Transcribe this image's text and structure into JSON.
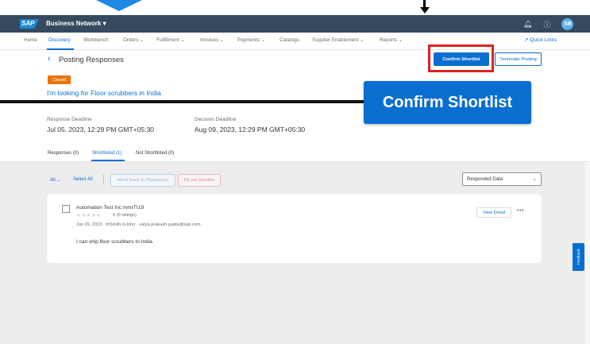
{
  "shell": {
    "logo_text": "SAP",
    "app_title": "Business Network ▾",
    "icons": [
      "bell-icon",
      "help-icon"
    ],
    "avatar_initials": "SB"
  },
  "nav": {
    "items": [
      {
        "label": "Home"
      },
      {
        "label": "Discovery"
      },
      {
        "label": "Workbench"
      },
      {
        "label": "Orders ⌄"
      },
      {
        "label": "Fulfillment ⌄"
      },
      {
        "label": "Invoices ⌄"
      },
      {
        "label": "Payments ⌄"
      },
      {
        "label": "Catalogs"
      },
      {
        "label": "Supplier Enablement ⌄"
      },
      {
        "label": "Reports ⌄"
      }
    ],
    "active": "Discovery",
    "quick_links": "↗ Quick Links"
  },
  "header": {
    "back_icon": "‹",
    "title": "Posting Responses",
    "confirm_label": "Confirm Shortlist",
    "terminate_label": "Terminate Posting",
    "status": "Closed",
    "posting_title": "I'm looking for Floor scrubbers in India"
  },
  "callout": {
    "label": "Confirm Shortlist"
  },
  "deadlines": {
    "response_label": "Response Deadline",
    "response_value": "Jul 05, 2023, 12:29 PM GMT+05:30",
    "decision_label": "Decision Deadline",
    "decision_value": "Aug 09, 2023, 12:29 PM GMT+05:30"
  },
  "tabs": [
    {
      "label": "Responses (0)"
    },
    {
      "label": "Shortlisted (1)"
    },
    {
      "label": "Not Shortlisted (0)"
    }
  ],
  "toolbar": {
    "all_label": "All ⌄",
    "select_all": "Select All",
    "move_back": "Move Back To Responses",
    "do_not_shortlist": "Do not Shortlist",
    "sort_value": "Responded Date",
    "sort_chevron": "⌄"
  },
  "card": {
    "supplier": "Automation Test Inc mmrTUJl",
    "stars": "★★★★★",
    "ratings": "0 (0 ratings)",
    "meta": "Jun 29, 2023 · fnSmith lnJohn · satya.prakash.gupta@sap.com",
    "message": "I can ship floor scrubbers to India.",
    "view_detail": "View Detail",
    "more": "•••"
  },
  "feedback": "Feedback"
}
